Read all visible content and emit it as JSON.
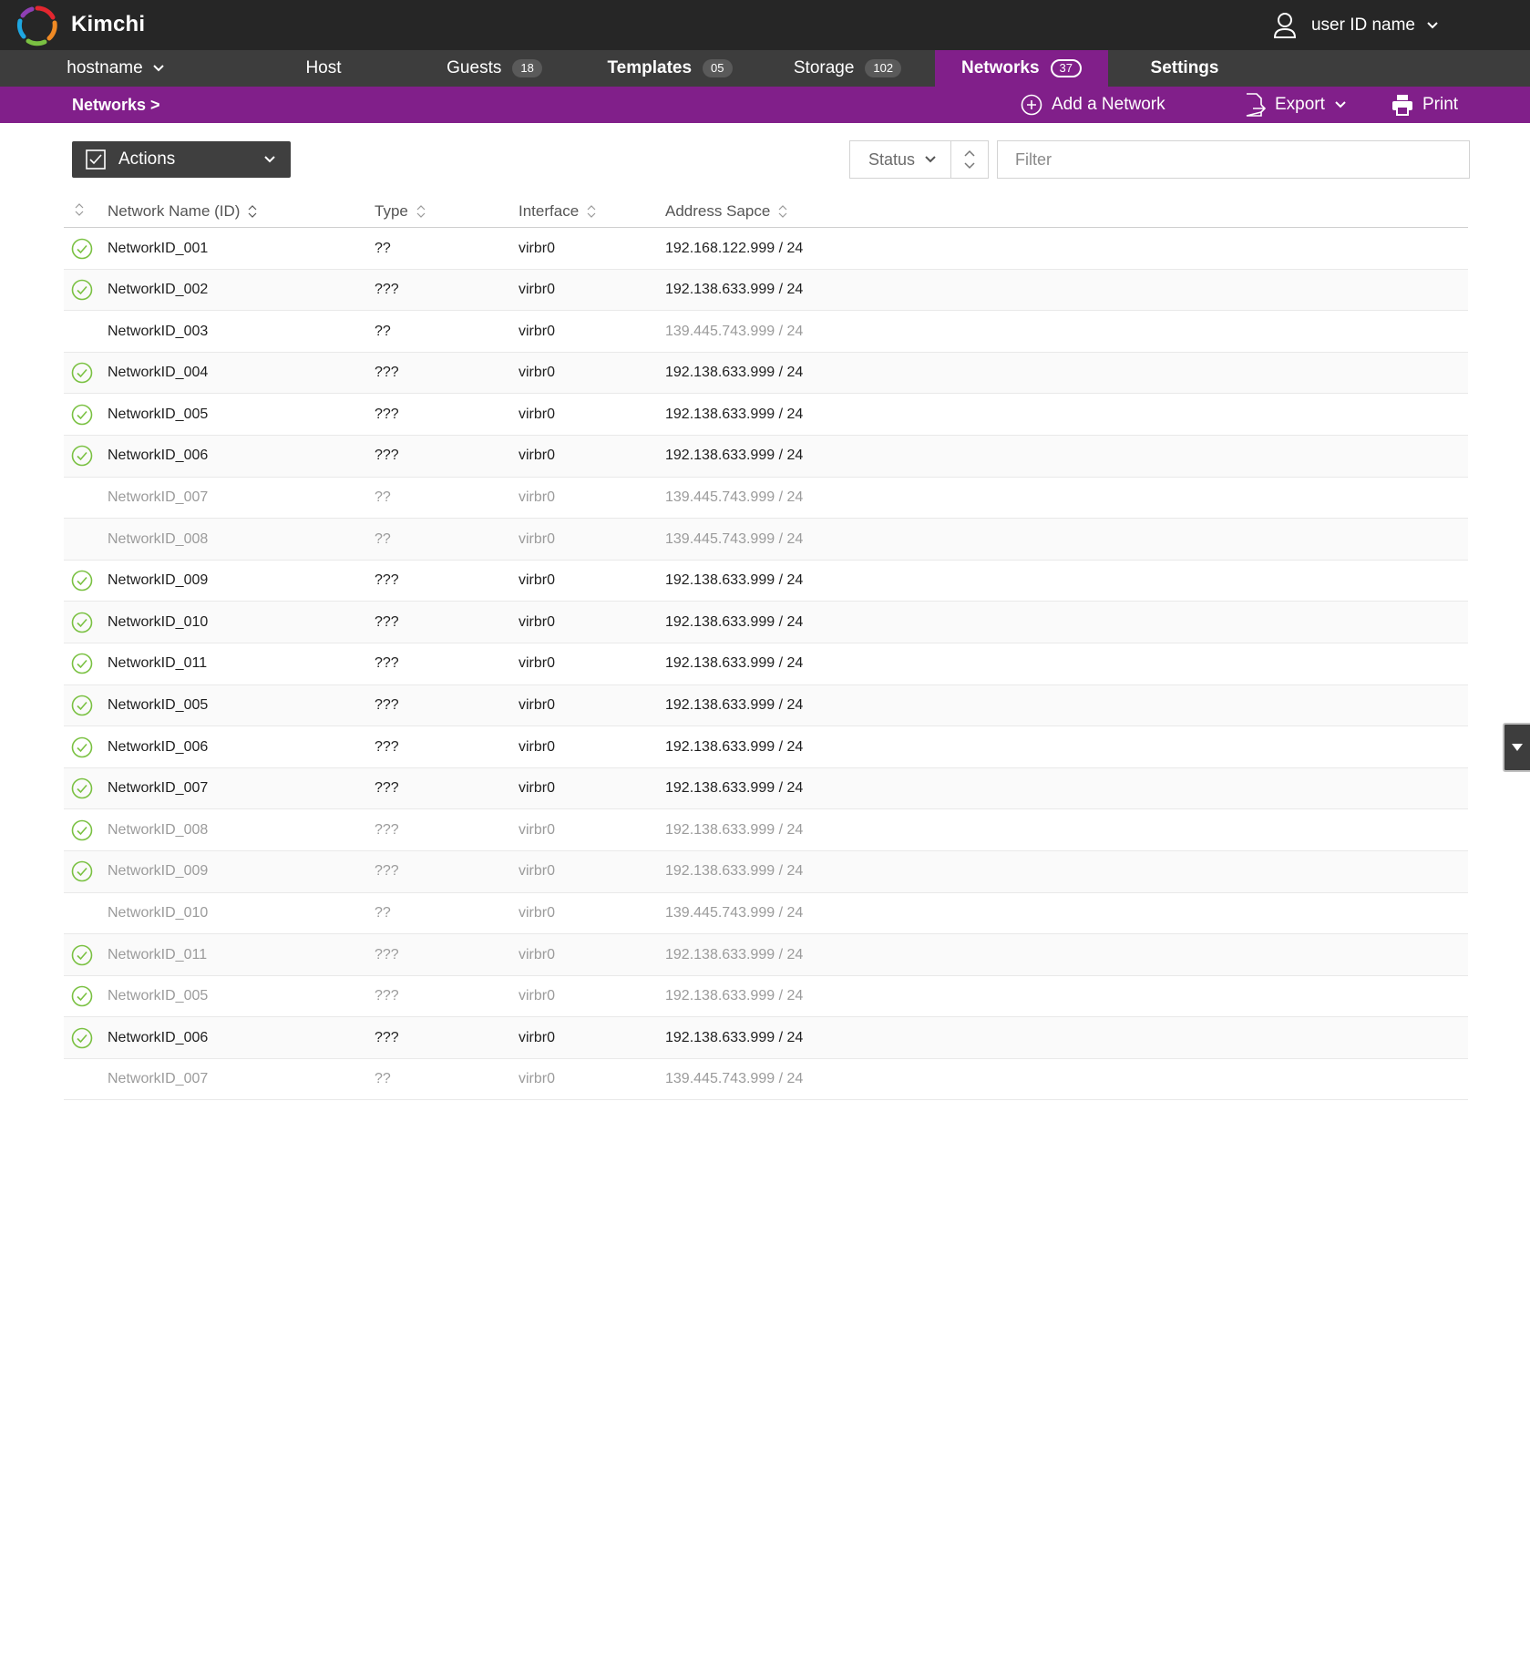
{
  "app": {
    "title": "Kimchi"
  },
  "user": {
    "name": "user ID name"
  },
  "nav": {
    "host_selector": "hostname",
    "items": [
      {
        "label": "Host",
        "badge": ""
      },
      {
        "label": "Guests",
        "badge": "18"
      },
      {
        "label": "Templates",
        "badge": "05"
      },
      {
        "label": "Storage",
        "badge": "102"
      },
      {
        "label": "Networks",
        "badge": "37"
      },
      {
        "label": "Settings",
        "badge": ""
      }
    ]
  },
  "subbar": {
    "breadcrumb": "Networks >",
    "add_label": "Add a Network",
    "export_label": "Export",
    "print_label": "Print"
  },
  "toolbar": {
    "actions_label": "Actions",
    "status_label": "Status",
    "filter_placeholder": "Filter"
  },
  "table": {
    "columns": [
      "Network Name (ID)",
      "Type",
      "Interface",
      "Address Sapce"
    ],
    "rows": [
      {
        "status": "ok",
        "dim": false,
        "name": "NetworkID_001",
        "type": "??",
        "iface": "virbr0",
        "addr": "192.168.122.999 / 24"
      },
      {
        "status": "ok",
        "dim": false,
        "name": "NetworkID_002",
        "type": "???",
        "iface": "virbr0",
        "addr": "192.138.633.999 / 24"
      },
      {
        "status": "none",
        "dim": false,
        "name": "NetworkID_003",
        "type": "??",
        "iface": "virbr0",
        "addr": "139.445.743.999 / 24",
        "addr_dim": true
      },
      {
        "status": "ok",
        "dim": false,
        "name": "NetworkID_004",
        "type": "???",
        "iface": "virbr0",
        "addr": "192.138.633.999 / 24"
      },
      {
        "status": "ok",
        "dim": false,
        "name": "NetworkID_005",
        "type": "???",
        "iface": "virbr0",
        "addr": "192.138.633.999 / 24"
      },
      {
        "status": "ok",
        "dim": false,
        "name": "NetworkID_006",
        "type": "???",
        "iface": "virbr0",
        "addr": "192.138.633.999 / 24"
      },
      {
        "status": "none",
        "dim": true,
        "name": "NetworkID_007",
        "type": "??",
        "iface": "virbr0",
        "addr": "139.445.743.999 / 24"
      },
      {
        "status": "none",
        "dim": true,
        "name": "NetworkID_008",
        "type": "??",
        "iface": "virbr0",
        "addr": "139.445.743.999 / 24"
      },
      {
        "status": "ok",
        "dim": false,
        "name": "NetworkID_009",
        "type": "???",
        "iface": "virbr0",
        "addr": "192.138.633.999 / 24"
      },
      {
        "status": "ok",
        "dim": false,
        "name": "NetworkID_010",
        "type": "???",
        "iface": "virbr0",
        "addr": "192.138.633.999 / 24"
      },
      {
        "status": "ok",
        "dim": false,
        "name": "NetworkID_011",
        "type": "???",
        "iface": "virbr0",
        "addr": "192.138.633.999 / 24"
      },
      {
        "status": "ok",
        "dim": false,
        "name": "NetworkID_005",
        "type": "???",
        "iface": "virbr0",
        "addr": "192.138.633.999 / 24"
      },
      {
        "status": "ok",
        "dim": false,
        "name": "NetworkID_006",
        "type": "???",
        "iface": "virbr0",
        "addr": "192.138.633.999 / 24"
      },
      {
        "status": "ok",
        "dim": false,
        "name": "NetworkID_007",
        "type": "???",
        "iface": "virbr0",
        "addr": "192.138.633.999 / 24"
      },
      {
        "status": "ok",
        "dim": true,
        "name": "NetworkID_008",
        "type": "???",
        "iface": "virbr0",
        "addr": "192.138.633.999 / 24"
      },
      {
        "status": "ok",
        "dim": true,
        "name": "NetworkID_009",
        "type": "???",
        "iface": "virbr0",
        "addr": "192.138.633.999 / 24"
      },
      {
        "status": "none",
        "dim": true,
        "name": "NetworkID_010",
        "type": "??",
        "iface": "virbr0",
        "addr": "139.445.743.999 / 24"
      },
      {
        "status": "ok",
        "dim": true,
        "name": "NetworkID_011",
        "type": "???",
        "iface": "virbr0",
        "addr": "192.138.633.999 / 24"
      },
      {
        "status": "ok",
        "dim": true,
        "name": "NetworkID_005",
        "type": "???",
        "iface": "virbr0",
        "addr": "192.138.633.999 / 24"
      },
      {
        "status": "ok",
        "dim": false,
        "name": "NetworkID_006",
        "type": "???",
        "iface": "virbr0",
        "addr": "192.138.633.999 / 24"
      },
      {
        "status": "none",
        "dim": true,
        "name": "NetworkID_007",
        "type": "??",
        "iface": "virbr0",
        "addr": "139.445.743.999 / 24"
      }
    ]
  },
  "colors": {
    "topbar": "#262626",
    "navbar": "#3d3d3d",
    "accent_purple": "#811f8a",
    "status_ok_green": "#7ac142",
    "dim_text": "#9b9b9b"
  },
  "icons": {
    "logo": "kimchi-logo-icon",
    "user": "user-icon",
    "add": "plus-circle-icon",
    "export": "export-icon",
    "print": "printer-icon",
    "actions": "checkbox-icon",
    "status_ok": "check-circle-icon",
    "sort": "sort-icon",
    "scroll": "caret-down-icon"
  }
}
